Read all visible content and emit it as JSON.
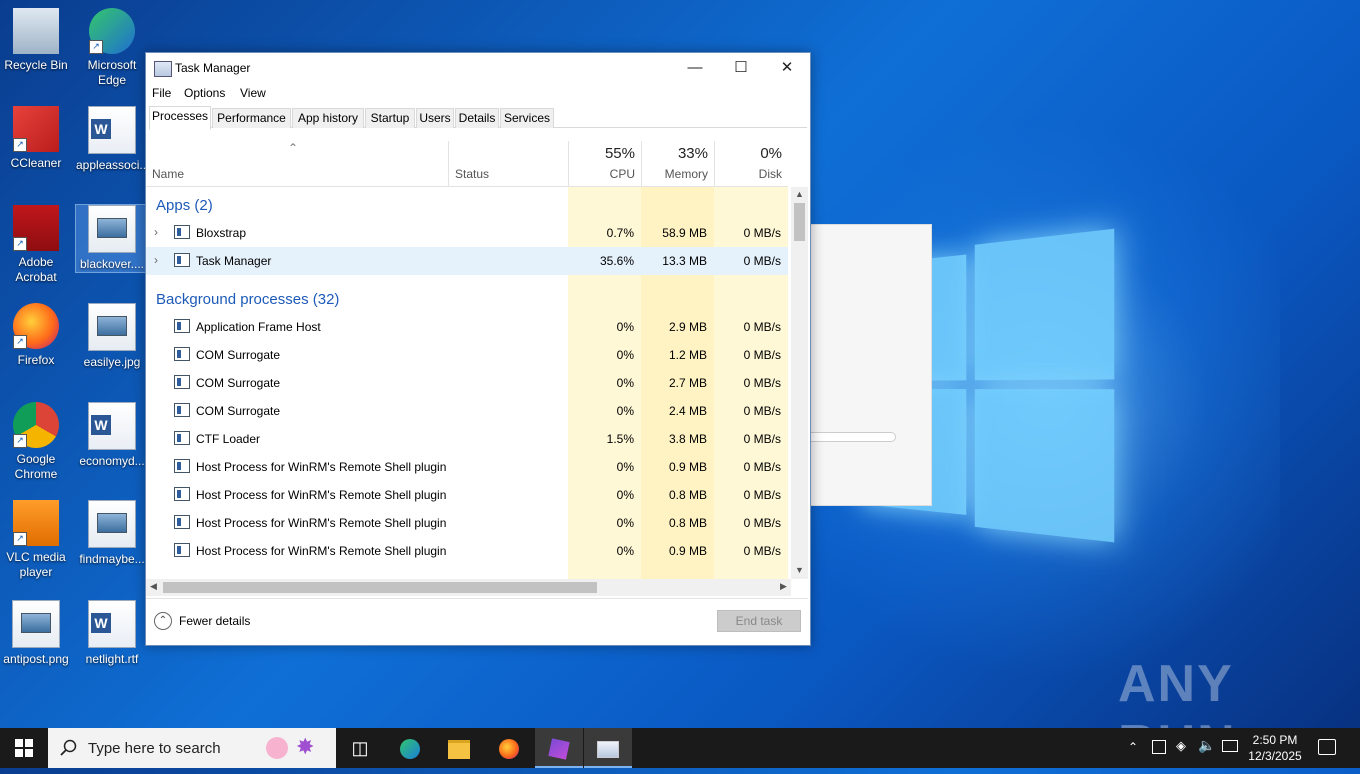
{
  "desktop": {
    "icons": [
      {
        "label": "Recycle Bin",
        "icon": "recycle-bin-icon"
      },
      {
        "label": "Microsoft Edge",
        "icon": "edge-icon"
      },
      {
        "label": "CCleaner",
        "icon": "ccleaner-icon"
      },
      {
        "label": "appleassoci...",
        "icon": "word-doc-icon"
      },
      {
        "label": "Adobe Acrobat",
        "icon": "acrobat-icon"
      },
      {
        "label": "blackover....",
        "icon": "image-file-icon"
      },
      {
        "label": "Firefox",
        "icon": "firefox-icon"
      },
      {
        "label": "easilye.jpg",
        "icon": "image-file-icon"
      },
      {
        "label": "Google Chrome",
        "icon": "chrome-icon"
      },
      {
        "label": "economyd...",
        "icon": "word-doc-icon"
      },
      {
        "label": "VLC media player",
        "icon": "vlc-icon"
      },
      {
        "label": "findmaybe...",
        "icon": "image-file-icon"
      },
      {
        "label": "antipost.png",
        "icon": "image-file-icon"
      },
      {
        "label": "netlight.rtf",
        "icon": "word-doc-icon"
      }
    ],
    "watermark": "ANY RUN"
  },
  "taskmanager": {
    "title": "Task Manager",
    "menu": [
      "File",
      "Options",
      "View"
    ],
    "tabs": [
      "Processes",
      "Performance",
      "App history",
      "Startup",
      "Users",
      "Details",
      "Services"
    ],
    "active_tab": "Processes",
    "columns": {
      "name": "Name",
      "status": "Status",
      "cpu": {
        "pct": "55%",
        "label": "CPU"
      },
      "memory": {
        "pct": "33%",
        "label": "Memory"
      },
      "disk": {
        "pct": "0%",
        "label": "Disk"
      }
    },
    "groups": {
      "apps": "Apps (2)",
      "background": "Background processes (32)"
    },
    "apps": [
      {
        "name": "Bloxstrap",
        "cpu": "0.7%",
        "memory": "58.9 MB",
        "disk": "0 MB/s"
      },
      {
        "name": "Task Manager",
        "cpu": "35.6%",
        "memory": "13.3 MB",
        "disk": "0 MB/s"
      }
    ],
    "background": [
      {
        "name": "Application Frame Host",
        "cpu": "0%",
        "memory": "2.9 MB",
        "disk": "0 MB/s"
      },
      {
        "name": "COM Surrogate",
        "cpu": "0%",
        "memory": "1.2 MB",
        "disk": "0 MB/s"
      },
      {
        "name": "COM Surrogate",
        "cpu": "0%",
        "memory": "2.7 MB",
        "disk": "0 MB/s"
      },
      {
        "name": "COM Surrogate",
        "cpu": "0%",
        "memory": "2.4 MB",
        "disk": "0 MB/s"
      },
      {
        "name": "CTF Loader",
        "cpu": "1.5%",
        "memory": "3.8 MB",
        "disk": "0 MB/s"
      },
      {
        "name": "Host Process for WinRM's Remote Shell plugin",
        "cpu": "0%",
        "memory": "0.9 MB",
        "disk": "0 MB/s"
      },
      {
        "name": "Host Process for WinRM's Remote Shell plugin",
        "cpu": "0%",
        "memory": "0.8 MB",
        "disk": "0 MB/s"
      },
      {
        "name": "Host Process for WinRM's Remote Shell plugin",
        "cpu": "0%",
        "memory": "0.8 MB",
        "disk": "0 MB/s"
      },
      {
        "name": "Host Process for WinRM's Remote Shell plugin",
        "cpu": "0%",
        "memory": "0.9 MB",
        "disk": "0 MB/s"
      }
    ],
    "footer": {
      "fewer_details": "Fewer details",
      "end_task": "End task"
    }
  },
  "taskbar": {
    "search_placeholder": "Type here to search",
    "time": "2:50 PM",
    "date": "12/3/2025"
  },
  "colors": {
    "accent": "#0078d7",
    "cpu_col": "#fff4c4",
    "mem_col": "#ffe9a8",
    "group_text": "#1e5bb8"
  }
}
